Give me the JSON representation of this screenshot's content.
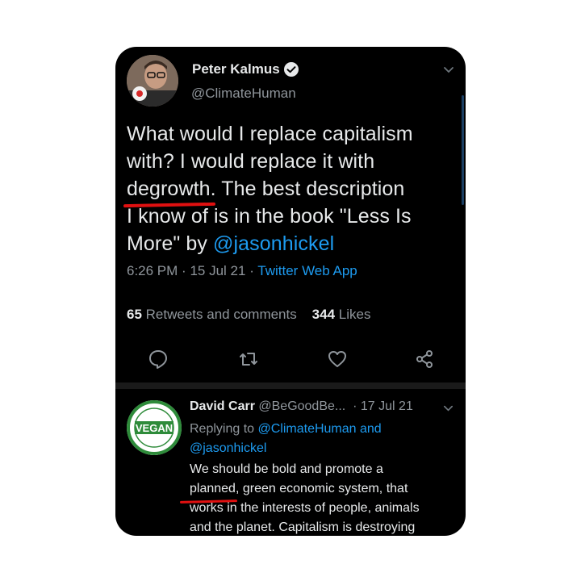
{
  "tweet": {
    "author_name": "Peter Kalmus",
    "handle": "@ClimateHuman",
    "text": {
      "line1": "What would I replace capitalism",
      "line2": "with? I would replace it with",
      "line3_underlined": "degrowth",
      "line3_rest": ". The best description",
      "line4": "I know of is in the book \"Less Is",
      "line5_pre": "More\" by ",
      "line5_mention": "@jasonhickel"
    },
    "time": "6:26 PM",
    "date": "15 Jul 21",
    "app": "Twitter Web App",
    "sep": "·",
    "retweets_count": "65",
    "retweets_label": "Retweets and comments",
    "likes_count": "344",
    "likes_label": "Likes"
  },
  "reply": {
    "author_name": "David Carr",
    "handle": "@BeGoodBe...",
    "date": "17 Jul 21",
    "sep": "·",
    "replying_prefix": "Replying to ",
    "replying_handle1": "@ClimateHuman",
    "replying_and": " and",
    "replying_handle2": "@jasonhickel",
    "text": {
      "line1": "We should be bold and promote a",
      "line2_underlined": "planned",
      "line2_rest": ", green economic system, that",
      "line3": "works in the interests of people, animals",
      "line4": "and the planet. Capitalism is destroying"
    },
    "avatar_badge_text": "VEGAN"
  },
  "icons": [
    "verified-badge-icon",
    "chevron-down-icon",
    "reply-icon",
    "retweet-icon",
    "like-icon",
    "share-icon"
  ],
  "colors": {
    "background": "#000000",
    "text": "#e7e9ea",
    "muted": "#8f959b",
    "accent": "#1d9bf0",
    "annotation": "#e01010",
    "vegan_green": "#2e8b3a"
  }
}
